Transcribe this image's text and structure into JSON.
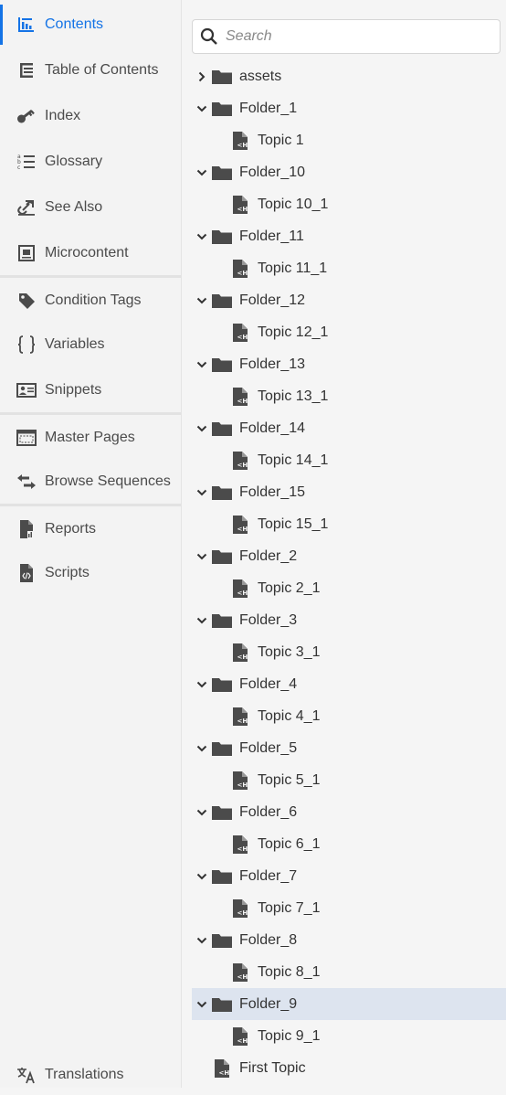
{
  "sidebar": {
    "items": [
      {
        "label": "Contents",
        "icon": "contents-icon",
        "active": true
      },
      {
        "label": "Table of Contents",
        "icon": "toc-icon"
      },
      {
        "label": "Index",
        "icon": "key-icon"
      },
      {
        "label": "Glossary",
        "icon": "glossary-icon"
      },
      {
        "label": "See Also",
        "icon": "link-icon"
      },
      {
        "label": "Microcontent",
        "icon": "microcontent-icon"
      },
      {
        "label": "Condition Tags",
        "icon": "tag-icon"
      },
      {
        "label": "Variables",
        "icon": "braces-icon"
      },
      {
        "label": "Snippets",
        "icon": "snippet-icon"
      },
      {
        "label": "Master Pages",
        "icon": "master-page-icon"
      },
      {
        "label": "Browse Sequences",
        "icon": "browse-sequence-icon"
      },
      {
        "label": "Reports",
        "icon": "report-icon"
      },
      {
        "label": "Scripts",
        "icon": "script-icon"
      },
      {
        "label": "Translations",
        "icon": "translate-icon"
      }
    ]
  },
  "search": {
    "placeholder": "Search"
  },
  "tree": {
    "items": [
      {
        "label": "assets",
        "type": "folder",
        "expanded": false
      },
      {
        "label": "Folder_1",
        "type": "folder",
        "expanded": true
      },
      {
        "label": "Topic 1",
        "type": "topic"
      },
      {
        "label": "Folder_10",
        "type": "folder",
        "expanded": true
      },
      {
        "label": "Topic 10_1",
        "type": "topic"
      },
      {
        "label": "Folder_11",
        "type": "folder",
        "expanded": true
      },
      {
        "label": "Topic 11_1",
        "type": "topic"
      },
      {
        "label": "Folder_12",
        "type": "folder",
        "expanded": true
      },
      {
        "label": "Topic 12_1",
        "type": "topic"
      },
      {
        "label": "Folder_13",
        "type": "folder",
        "expanded": true
      },
      {
        "label": "Topic 13_1",
        "type": "topic"
      },
      {
        "label": "Folder_14",
        "type": "folder",
        "expanded": true
      },
      {
        "label": "Topic 14_1",
        "type": "topic"
      },
      {
        "label": "Folder_15",
        "type": "folder",
        "expanded": true
      },
      {
        "label": "Topic 15_1",
        "type": "topic"
      },
      {
        "label": "Folder_2",
        "type": "folder",
        "expanded": true
      },
      {
        "label": "Topic 2_1",
        "type": "topic"
      },
      {
        "label": "Folder_3",
        "type": "folder",
        "expanded": true
      },
      {
        "label": "Topic 3_1",
        "type": "topic"
      },
      {
        "label": "Folder_4",
        "type": "folder",
        "expanded": true
      },
      {
        "label": "Topic 4_1",
        "type": "topic"
      },
      {
        "label": "Folder_5",
        "type": "folder",
        "expanded": true
      },
      {
        "label": "Topic 5_1",
        "type": "topic"
      },
      {
        "label": "Folder_6",
        "type": "folder",
        "expanded": true
      },
      {
        "label": "Topic 6_1",
        "type": "topic"
      },
      {
        "label": "Folder_7",
        "type": "folder",
        "expanded": true
      },
      {
        "label": "Topic 7_1",
        "type": "topic"
      },
      {
        "label": "Folder_8",
        "type": "folder",
        "expanded": true
      },
      {
        "label": "Topic 8_1",
        "type": "topic"
      },
      {
        "label": "Folder_9",
        "type": "folder",
        "expanded": true,
        "selected": true
      },
      {
        "label": "Topic 9_1",
        "type": "topic"
      },
      {
        "label": "First Topic",
        "type": "root-topic"
      }
    ]
  },
  "colors": {
    "accent": "#1473e6",
    "selection": "#dde4ef",
    "icon": "#4b4b4b"
  }
}
